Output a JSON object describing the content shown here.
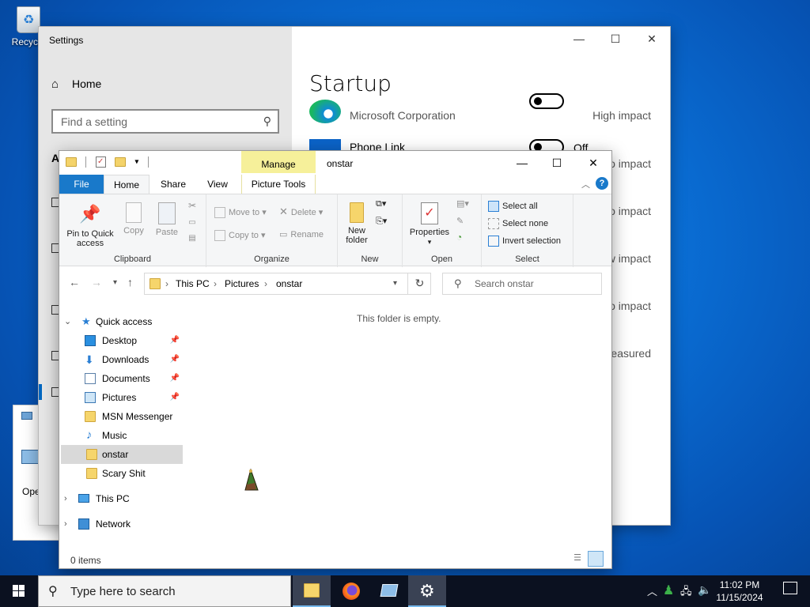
{
  "desktop": {
    "recycle_label": "Recycle"
  },
  "bg_window": {
    "label": "Ope"
  },
  "settings": {
    "window_title": "Settings",
    "home_label": "Home",
    "search_placeholder": "Find a setting",
    "side_letter": "A",
    "page_title": "Startup",
    "apps": [
      {
        "name": "",
        "publisher": "Microsoft Corporation",
        "state": "Off",
        "impact": "High impact"
      },
      {
        "name": "Phone Link",
        "publisher": "",
        "state": "Off",
        "impact": "o impact"
      }
    ],
    "impacts_hidden": [
      "o impact",
      "o impact",
      "w impact",
      "o impact",
      "easured"
    ]
  },
  "explorer": {
    "title": "onstar",
    "manage_tab": "Manage",
    "tabs": {
      "file": "File",
      "home": "Home",
      "share": "Share",
      "view": "View",
      "picture_tools": "Picture Tools"
    },
    "ribbon": {
      "clipboard": {
        "label": "Clipboard",
        "pin": "Pin to Quick access",
        "copy": "Copy",
        "paste": "Paste"
      },
      "organize": {
        "label": "Organize",
        "move_to": "Move to",
        "copy_to": "Copy to",
        "delete": "Delete",
        "rename": "Rename"
      },
      "new": {
        "label": "New",
        "new_folder": "New folder"
      },
      "open": {
        "label": "Open",
        "properties": "Properties"
      },
      "select": {
        "label": "Select",
        "select_all": "Select all",
        "select_none": "Select none",
        "invert": "Invert selection"
      }
    },
    "address": {
      "seg1": "This PC",
      "seg2": "Pictures",
      "seg3": "onstar"
    },
    "search_placeholder": "Search onstar",
    "nav": {
      "quick_access": "Quick access",
      "items": [
        {
          "label": "Desktop",
          "pinned": true
        },
        {
          "label": "Downloads",
          "pinned": true
        },
        {
          "label": "Documents",
          "pinned": true
        },
        {
          "label": "Pictures",
          "pinned": true
        },
        {
          "label": "MSN Messenger",
          "pinned": false
        },
        {
          "label": "Music",
          "pinned": false
        },
        {
          "label": "onstar",
          "pinned": false
        },
        {
          "label": "Scary Shit",
          "pinned": false
        }
      ],
      "this_pc": "This PC",
      "network": "Network"
    },
    "empty_message": "This folder is empty.",
    "status": "0 items"
  },
  "taskbar": {
    "search_placeholder": "Type here to search",
    "time": "11:02 PM",
    "date": "11/15/2024"
  }
}
